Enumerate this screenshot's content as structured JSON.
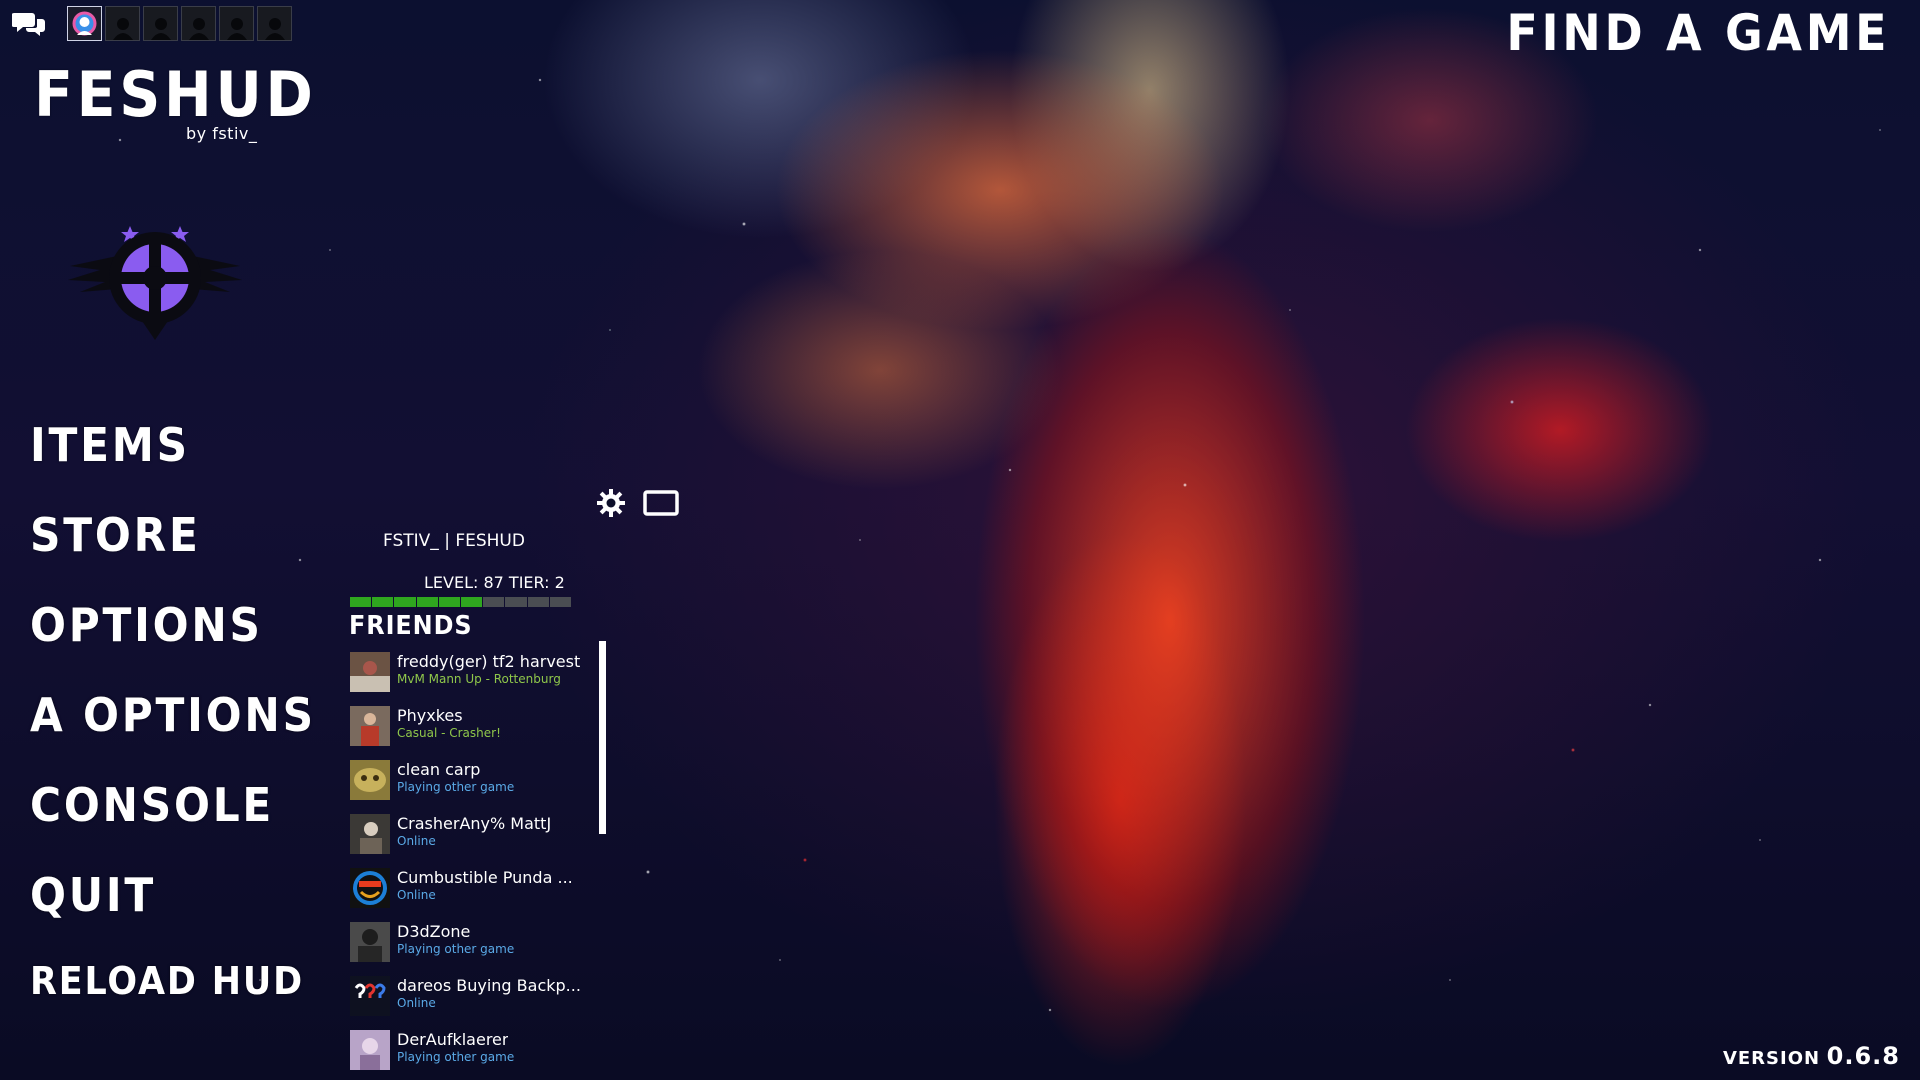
{
  "header": {
    "title": "FESHUD",
    "subtitle": "by fstiv_",
    "find_game": "FIND A GAME"
  },
  "party": {
    "chat_icon": "chat-bubbles-icon",
    "slots": 6
  },
  "menu": {
    "items": [
      {
        "label": "ITEMS"
      },
      {
        "label": "STORE"
      },
      {
        "label": "OPTIONS"
      },
      {
        "label": "A OPTIONS"
      },
      {
        "label": "CONSOLE"
      },
      {
        "label": "QUIT"
      },
      {
        "label": "RELOAD HUD"
      }
    ]
  },
  "toolbar": {
    "settings_icon": "gear-icon",
    "window_icon": "window-icon"
  },
  "profile": {
    "name": "FSTIV_ | FESHUD",
    "level_text": "LEVEL: 87 TIER: 2",
    "xp_progress": 0.6
  },
  "friends": {
    "title": "FRIENDS",
    "list": [
      {
        "name": "freddy(ger) tf2 harvest",
        "status": "MvM Mann Up - Rottenburg",
        "state": "ingame"
      },
      {
        "name": "Phyxkes",
        "status": "Casual - Crasher!",
        "state": "ingame"
      },
      {
        "name": "clean carp",
        "status": "Playing other game",
        "state": "online"
      },
      {
        "name": "CrasherAny% MattJ",
        "status": "Online",
        "state": "online"
      },
      {
        "name": "Cumbustible Punda ...",
        "status": "Online",
        "state": "online"
      },
      {
        "name": "D3dZone",
        "status": "Playing other game",
        "state": "online"
      },
      {
        "name": "dareos Buying Backp...",
        "status": "Online",
        "state": "online"
      },
      {
        "name": "DerAufklaerer",
        "status": "Playing other game",
        "state": "online"
      }
    ]
  },
  "footer": {
    "version_label": "VERSION",
    "version_number": "0.6.8"
  },
  "colors": {
    "accent_purple": "#8a5cf0",
    "ingame_status": "#8fc74a",
    "online_status": "#5aa9e6",
    "xp_fill": "#2fa71f"
  }
}
